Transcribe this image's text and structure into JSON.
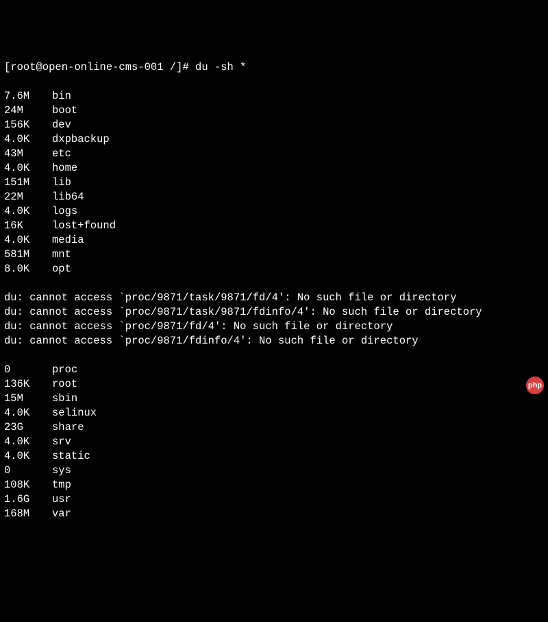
{
  "prompt": "[root@open-online-cms-001 /]# du -sh *",
  "entries_before_errors": [
    {
      "size": "7.6M",
      "name": "bin"
    },
    {
      "size": "24M",
      "name": "boot"
    },
    {
      "size": "156K",
      "name": "dev"
    },
    {
      "size": "4.0K",
      "name": "dxpbackup"
    },
    {
      "size": "43M",
      "name": "etc"
    },
    {
      "size": "4.0K",
      "name": "home"
    },
    {
      "size": "151M",
      "name": "lib"
    },
    {
      "size": "22M",
      "name": "lib64"
    },
    {
      "size": "4.0K",
      "name": "logs"
    },
    {
      "size": "16K",
      "name": "lost+found"
    },
    {
      "size": "4.0K",
      "name": "media"
    },
    {
      "size": "581M",
      "name": "mnt"
    },
    {
      "size": "8.0K",
      "name": "opt"
    }
  ],
  "errors": [
    "du: cannot access `proc/9871/task/9871/fd/4': No such file or directory",
    "du: cannot access `proc/9871/task/9871/fdinfo/4': No such file or directory",
    "du: cannot access `proc/9871/fd/4': No such file or directory",
    "du: cannot access `proc/9871/fdinfo/4': No such file or directory"
  ],
  "entries_after_errors": [
    {
      "size": "0",
      "name": "proc"
    },
    {
      "size": "136K",
      "name": "root"
    },
    {
      "size": "15M",
      "name": "sbin"
    },
    {
      "size": "4.0K",
      "name": "selinux"
    },
    {
      "size": "23G",
      "name": "share"
    },
    {
      "size": "4.0K",
      "name": "srv"
    },
    {
      "size": "4.0K",
      "name": "static"
    },
    {
      "size": "0",
      "name": "sys"
    },
    {
      "size": "108K",
      "name": "tmp"
    },
    {
      "size": "1.6G",
      "name": "usr"
    },
    {
      "size": "168M",
      "name": "var"
    }
  ],
  "badge_text": "php"
}
